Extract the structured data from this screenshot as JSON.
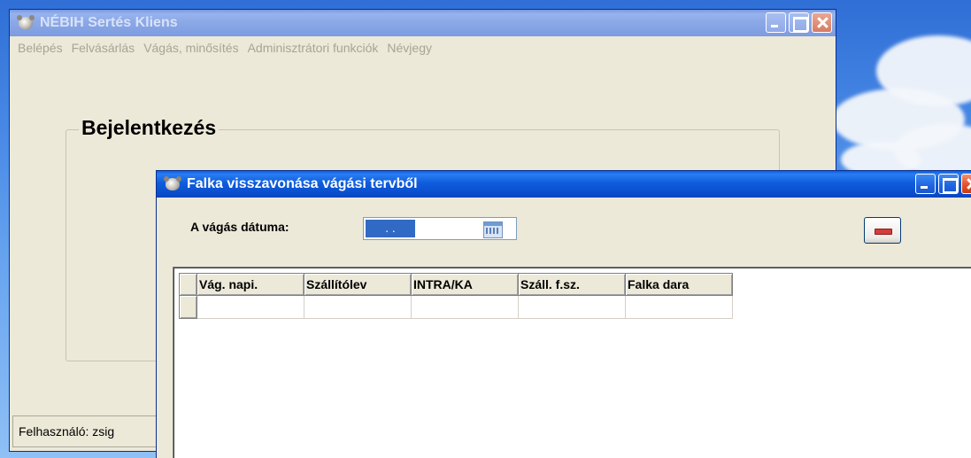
{
  "main_window": {
    "title": "NÉBIH Sertés Kliens",
    "menu": [
      "Belépés",
      "Felvásárlás",
      "Vágás, minősítés",
      "Adminisztrátori funkciók",
      "Névjegy"
    ],
    "group_title": "Bejelentkezés",
    "status_text": "Felhasználó: zsig"
  },
  "dialog": {
    "title": "Falka visszavonása vágási tervből",
    "date_label": "A vágás dátuma:",
    "date_value": ". .",
    "grid_columns": [
      "Vág. napi.",
      "Szállítólev",
      "INTRA/KA",
      "Száll. f.sz.",
      "Falka dara"
    ]
  },
  "colors": {
    "active_title": "#0a4fcf",
    "inactive_title": "#8aa7e6",
    "dialog_bg": "#ece9d8",
    "selection": "#316ac5",
    "remove_red": "#d83b3b"
  },
  "icons": [
    "pig-icon",
    "minimize-icon",
    "maximize-icon",
    "close-icon",
    "calendar-icon",
    "remove-icon"
  ]
}
